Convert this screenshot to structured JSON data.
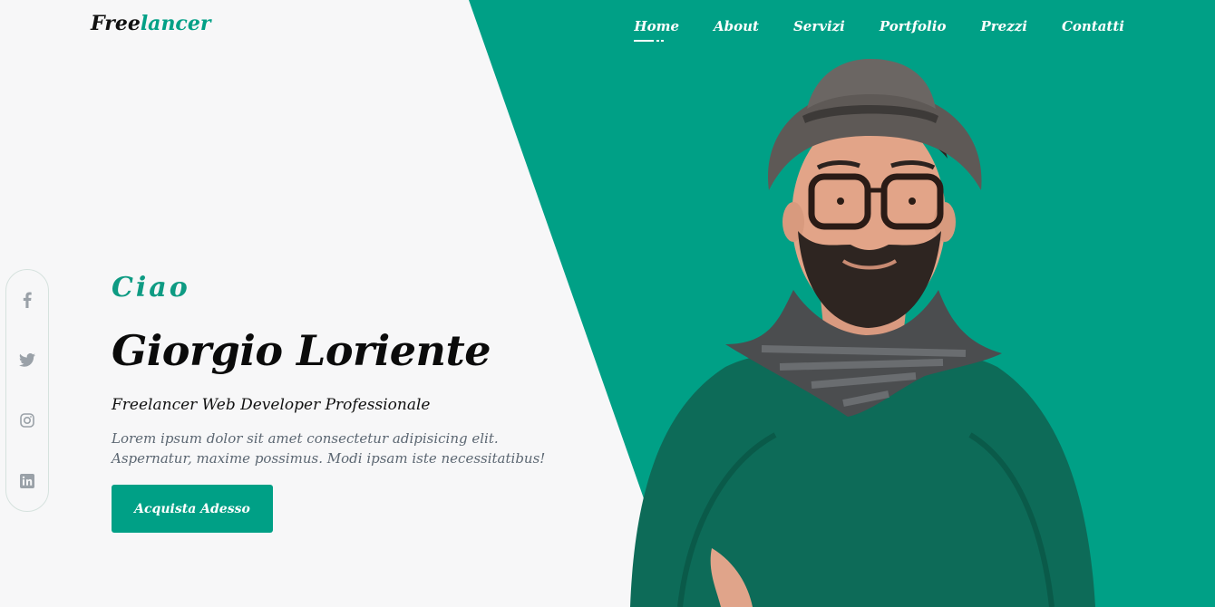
{
  "logo": {
    "part1": "Free",
    "part2": "lancer"
  },
  "nav": {
    "items": [
      "Home",
      "About",
      "Servizi",
      "Portfolio",
      "Prezzi",
      "Contatti"
    ],
    "active": "Home"
  },
  "social": {
    "icons": [
      "facebook-icon",
      "twitter-icon",
      "instagram-icon",
      "linkedin-icon"
    ]
  },
  "hero": {
    "greeting": "Ciao",
    "name": "Giorgio Loriente",
    "role": "Freelancer Web Developer Professionale",
    "description": "Lorem ipsum dolor sit amet consectetur adipisicing elit. Aspernatur, maxime possimus. Modi ipsam iste necessitatibus!",
    "cta_label": "Acquista Adesso"
  },
  "colors": {
    "accent": "#00a086",
    "background": "#f7f7f8",
    "text_dark": "#0b0b0b",
    "text_muted": "#5c6772"
  }
}
